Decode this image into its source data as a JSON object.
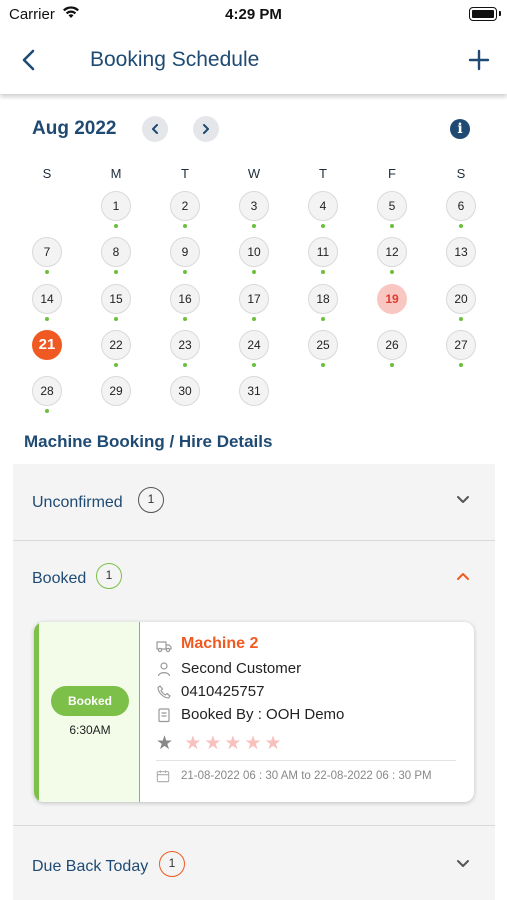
{
  "status_bar": {
    "carrier": "Carrier",
    "time": "4:29 PM"
  },
  "nav": {
    "title": "Booking Schedule"
  },
  "calendar": {
    "month": "Aug 2022",
    "weekdays": [
      "S",
      "M",
      "T",
      "W",
      "T",
      "F",
      "S"
    ],
    "days": [
      "1",
      "2",
      "3",
      "4",
      "5",
      "6",
      "7",
      "8",
      "9",
      "10",
      "11",
      "12",
      "13",
      "14",
      "15",
      "16",
      "17",
      "18",
      "19",
      "20",
      "21",
      "22",
      "23",
      "24",
      "25",
      "26",
      "27",
      "28",
      "29",
      "30",
      "31"
    ],
    "selected_day": "21",
    "highlighted_day": "19"
  },
  "section_heading": "Machine Booking / Hire Details",
  "accordion": [
    {
      "title": "Unconfirmed",
      "count": "1",
      "expanded": false,
      "badge_color": "#555555"
    },
    {
      "title": "Booked",
      "count": "1",
      "expanded": true,
      "badge_color": "#7cc04a"
    },
    {
      "title": "Due Back Today",
      "count": "1",
      "expanded": false,
      "badge_color": "#f05a22"
    }
  ],
  "booking_card": {
    "status": "Booked",
    "time": "6:30AM",
    "machine": "Machine 2",
    "customer": "Second Customer",
    "phone": "0410425757",
    "booked_by": "Booked By : OOH Demo",
    "rating": 0,
    "max_rating": 5,
    "date_range": "21-08-2022 06 : 30 AM to 22-08-2022 06 : 30 PM"
  },
  "colors": {
    "primary": "#1f4a73",
    "accent": "#f05a22",
    "success": "#7cc04a",
    "dot": "#6bbf3c"
  },
  "icons": [
    "wifi-icon",
    "battery-icon",
    "back-arrow-icon",
    "plus-icon",
    "chevron-left-icon",
    "chevron-right-icon",
    "info-icon",
    "chevron-down-icon",
    "chevron-up-icon",
    "truck-icon",
    "user-icon",
    "phone-icon",
    "clipboard-icon",
    "star-icon",
    "calendar-icon"
  ]
}
